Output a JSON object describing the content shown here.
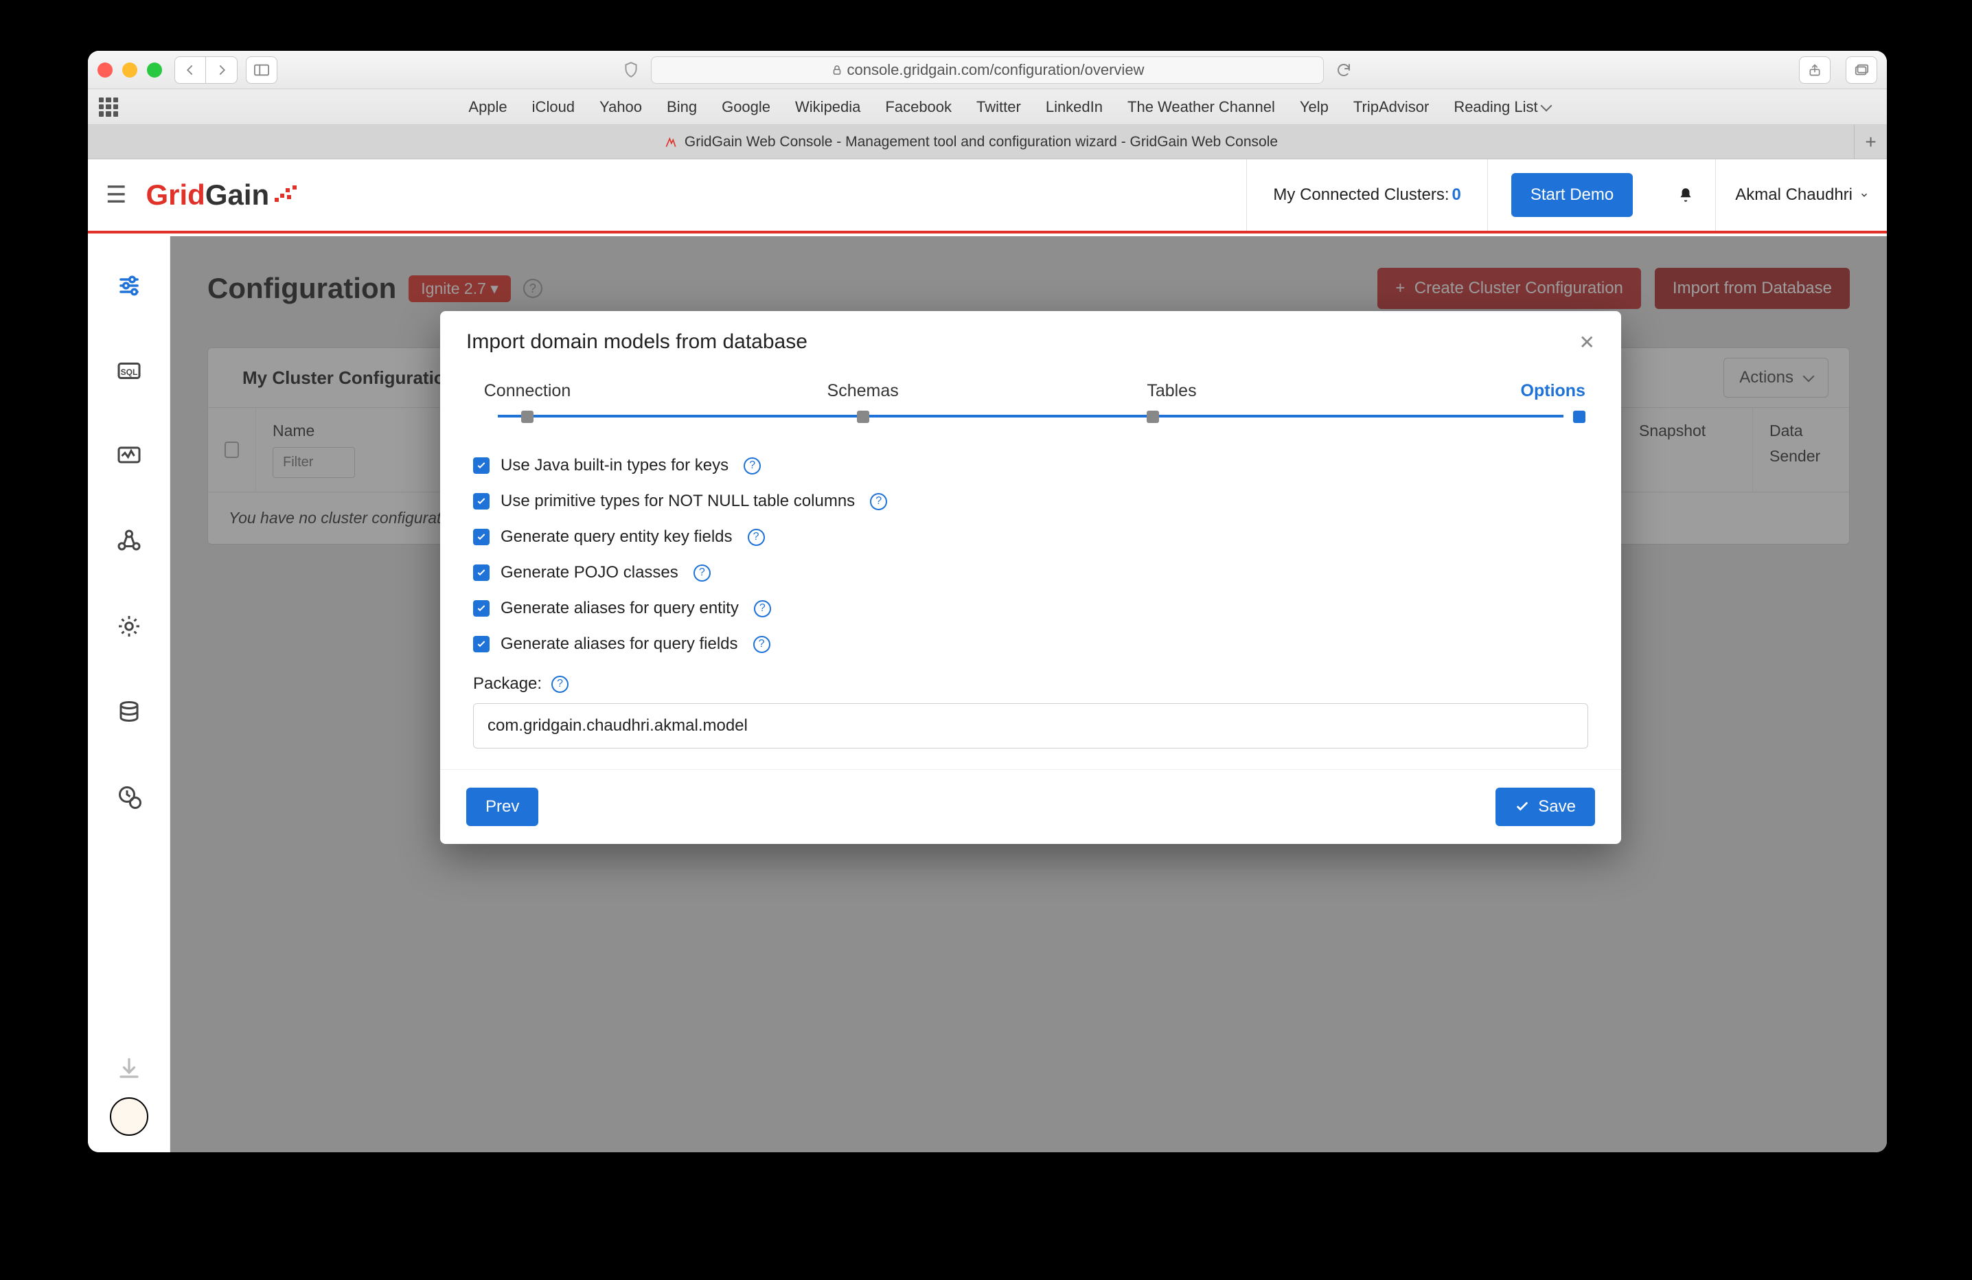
{
  "browser": {
    "url": "console.gridgain.com/configuration/overview",
    "bookmarks": [
      "Apple",
      "iCloud",
      "Yahoo",
      "Bing",
      "Google",
      "Wikipedia",
      "Facebook",
      "Twitter",
      "LinkedIn",
      "The Weather Channel",
      "Yelp",
      "TripAdvisor",
      "Reading List"
    ],
    "tab_title": "GridGain Web Console - Management tool and configuration wizard - GridGain Web Console"
  },
  "topbar": {
    "brand_a": "Grid",
    "brand_b": "Gain",
    "clusters_label": "My Connected Clusters:",
    "clusters_count": "0",
    "demo_label": "Start Demo",
    "user_name": "Akmal Chaudhri"
  },
  "page": {
    "title": "Configuration",
    "chip": "Ignite 2.7",
    "create_btn": "Create Cluster Configuration",
    "import_btn": "Import from Database"
  },
  "table": {
    "tab_label": "My Cluster Configurations",
    "actions_label": "Actions",
    "columns": {
      "name": "Name",
      "snapshot": "Snapshot",
      "data": "Data",
      "sender": "Sender"
    },
    "filter_placeholder": "Filter",
    "empty_row": "You have no cluster configurations."
  },
  "modal": {
    "title": "Import domain models from database",
    "steps": [
      "Connection",
      "Schemas",
      "Tables",
      "Options"
    ],
    "options": [
      "Use Java built-in types for keys",
      "Use primitive types for NOT NULL table columns",
      "Generate query entity key fields",
      "Generate POJO classes",
      "Generate aliases for query entity",
      "Generate aliases for query fields"
    ],
    "package_label": "Package:",
    "package_value": "com.gridgain.chaudhri.akmal.model",
    "prev": "Prev",
    "save": "Save"
  }
}
